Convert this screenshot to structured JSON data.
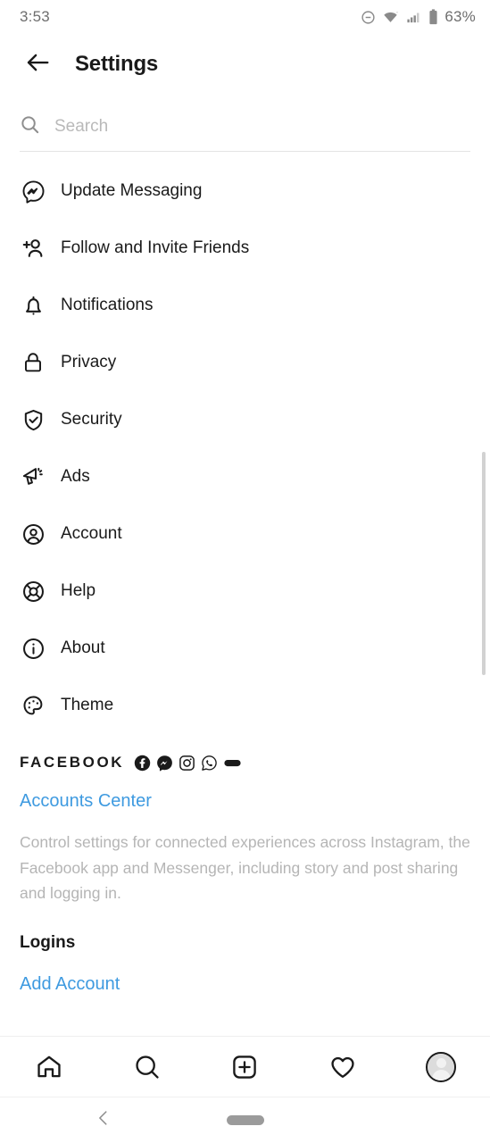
{
  "status_bar": {
    "time": "3:53",
    "battery_percent": "63%",
    "icons": [
      "do-not-disturb-icon",
      "wifi-icon",
      "cellular-signal-icon",
      "battery-icon"
    ]
  },
  "header": {
    "back_icon": "arrow-left-icon",
    "title": "Settings"
  },
  "search": {
    "icon": "search-icon",
    "placeholder": "Search",
    "value": ""
  },
  "menu": {
    "items": [
      {
        "label": "Update Messaging",
        "icon": "messenger-icon"
      },
      {
        "label": "Follow and Invite Friends",
        "icon": "person-add-icon"
      },
      {
        "label": "Notifications",
        "icon": "bell-icon"
      },
      {
        "label": "Privacy",
        "icon": "lock-icon"
      },
      {
        "label": "Security",
        "icon": "shield-check-icon"
      },
      {
        "label": "Ads",
        "icon": "megaphone-icon"
      },
      {
        "label": "Account",
        "icon": "user-circle-icon"
      },
      {
        "label": "Help",
        "icon": "lifebuoy-icon"
      },
      {
        "label": "About",
        "icon": "info-circle-icon"
      },
      {
        "label": "Theme",
        "icon": "palette-icon"
      }
    ]
  },
  "facebook_section": {
    "brand_word": "FACEBOOK",
    "product_icons": [
      "facebook-icon",
      "messenger-icon",
      "instagram-icon",
      "whatsapp-icon",
      "oculus-icon"
    ],
    "accounts_center_link": "Accounts Center",
    "description": "Control settings for connected experiences across Instagram, the Facebook app and Messenger, including story and post sharing and logging in.",
    "logins_heading": "Logins",
    "add_account_link": "Add Account"
  },
  "tabbar": {
    "items": [
      {
        "name": "home",
        "icon": "home-icon"
      },
      {
        "name": "search",
        "icon": "search-icon"
      },
      {
        "name": "create",
        "icon": "plus-square-icon"
      },
      {
        "name": "activity",
        "icon": "heart-icon"
      },
      {
        "name": "profile",
        "icon": "avatar-icon"
      }
    ]
  },
  "system_nav": {
    "back_icon": "chevron-left-icon",
    "home_pill": "gesture-pill"
  },
  "colors": {
    "link_blue": "#3e9ae0",
    "text_primary": "#1a1a1a",
    "text_muted": "#b5b5b5",
    "divider": "#efefef"
  }
}
